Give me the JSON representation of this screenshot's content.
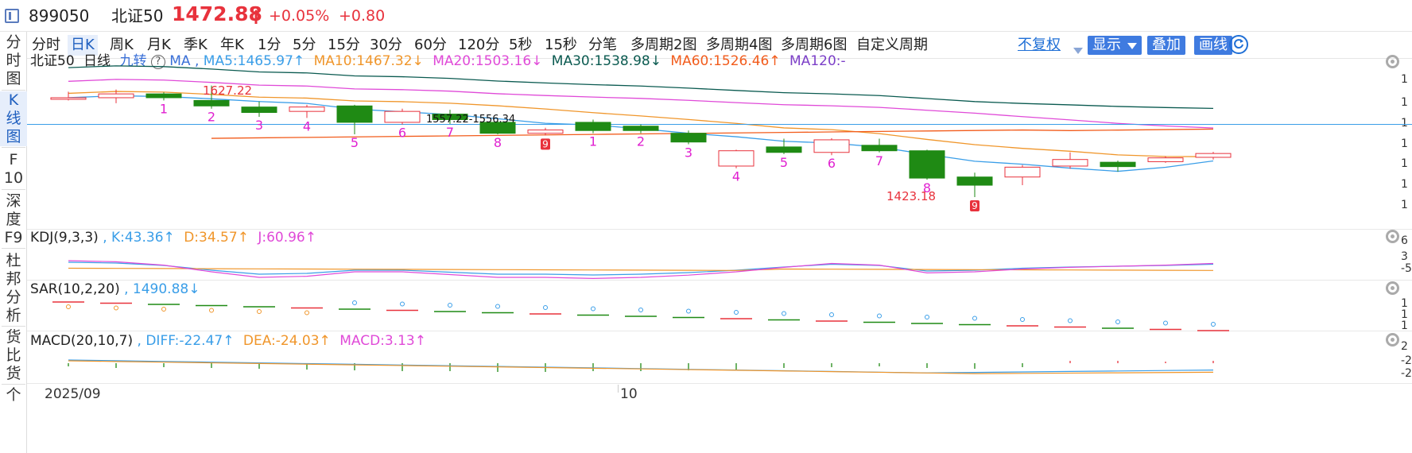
{
  "header": {
    "code": "899050",
    "name": "北证50",
    "price": "1472.88",
    "change_pct": "+0.05%",
    "change": "+0.80",
    "up_color": "#e8323c"
  },
  "left_nav": {
    "items": [
      "分时图",
      "K线图",
      "F10",
      "深度F9",
      "杜邦分析",
      "货比货",
      "个"
    ],
    "active_index": 1
  },
  "toolbar": {
    "periods": [
      "分时",
      "日K",
      "周K",
      "月K",
      "季K",
      "年K",
      "1分",
      "5分",
      "15分",
      "30分",
      "60分",
      "120分",
      "5秒",
      "15秒",
      "分笔",
      "多周期2图",
      "多周期4图",
      "多周期6图",
      "自定义周期"
    ],
    "active_index": 1,
    "adjust_label": "不复权",
    "display_label": "显示",
    "overlay_label": "叠加",
    "draw_label": "画线"
  },
  "main_legend": {
    "name": "北证50",
    "period": "日线",
    "nine_turn": "九转",
    "ma_label": "MA ,",
    "ma5": "MA5:1465.97↑",
    "ma10": "MA10:1467.32↓",
    "ma20": "MA20:1503.16↓",
    "ma30": "MA30:1538.98↓",
    "ma60": "MA60:1526.46↑",
    "ma120": "MA120:-",
    "high_label": "1627.22",
    "low_label": "1423.18",
    "range_label": "1557.22-1556.34"
  },
  "kdj_legend": {
    "name": "KDJ(9,3,3)",
    "k": ", K:43.36↑",
    "d": "D:34.57↑",
    "j": "J:60.96↑"
  },
  "sar_legend": {
    "name": "SAR(10,2,20)",
    "value": ", 1490.88↓"
  },
  "macd_legend": {
    "name": "MACD(20,10,7)",
    "diff": ", DIFF:-22.47↑",
    "dea": "DEA:-24.03↑",
    "macd": "MACD:3.13↑"
  },
  "right_axis": {
    "main": [
      "1",
      "1",
      "1",
      "1",
      "1",
      "1",
      "1"
    ],
    "kdj": [
      "6",
      "3",
      "-5"
    ],
    "sar": [
      "1",
      "1",
      "1"
    ],
    "macd": [
      "2",
      "-2",
      "-2"
    ]
  },
  "x_axis": {
    "labels": [
      "2025/09",
      "10"
    ]
  },
  "colors": {
    "up": "#e8323c",
    "down": "#1f8a14",
    "ma5": "#3a9ee8",
    "ma10": "#f0962b",
    "ma20": "#e04ad8",
    "ma30": "#0a5a50",
    "ma60": "#f25c1c",
    "ma120": "#7c3fc8",
    "nine_turn": "#e020d0"
  },
  "chart_data": {
    "type": "candlestick",
    "ylim": [
      1400,
      1650
    ],
    "candles": [
      {
        "o": 1605,
        "c": 1605,
        "h": 1616,
        "l": 1600
      },
      {
        "o": 1605,
        "c": 1612,
        "h": 1620,
        "l": 1595
      },
      {
        "o": 1612,
        "c": 1605,
        "h": 1615,
        "l": 1600
      },
      {
        "o": 1600,
        "c": 1590,
        "h": 1627.22,
        "l": 1585
      },
      {
        "o": 1588,
        "c": 1578,
        "h": 1598,
        "l": 1570
      },
      {
        "o": 1580,
        "c": 1588,
        "h": 1592,
        "l": 1568
      },
      {
        "o": 1590,
        "c": 1560,
        "h": 1592,
        "l": 1538
      },
      {
        "o": 1560,
        "c": 1580,
        "h": 1585,
        "l": 1556
      },
      {
        "o": 1575,
        "c": 1565,
        "h": 1583,
        "l": 1557.22
      },
      {
        "o": 1560,
        "c": 1540,
        "h": 1565,
        "l": 1538
      },
      {
        "o": 1540,
        "c": 1546,
        "h": 1550,
        "l": 1536
      },
      {
        "o": 1560,
        "c": 1545,
        "h": 1565,
        "l": 1540
      },
      {
        "o": 1553,
        "c": 1545,
        "h": 1556,
        "l": 1540
      },
      {
        "o": 1540,
        "c": 1524,
        "h": 1545,
        "l": 1520
      },
      {
        "o": 1480,
        "c": 1508,
        "h": 1510,
        "l": 1476
      },
      {
        "o": 1515,
        "c": 1505,
        "h": 1530,
        "l": 1502
      },
      {
        "o": 1505,
        "c": 1528,
        "h": 1531,
        "l": 1500
      },
      {
        "o": 1518,
        "c": 1508,
        "h": 1530,
        "l": 1505
      },
      {
        "o": 1508,
        "c": 1458,
        "h": 1510,
        "l": 1455
      },
      {
        "o": 1460,
        "c": 1445,
        "h": 1468,
        "l": 1423.18
      },
      {
        "o": 1460,
        "c": 1478,
        "h": 1482,
        "l": 1445
      },
      {
        "o": 1480,
        "c": 1492,
        "h": 1505,
        "l": 1475
      },
      {
        "o": 1487,
        "c": 1479,
        "h": 1490,
        "l": 1470
      },
      {
        "o": 1488,
        "c": 1495,
        "h": 1498,
        "l": 1486
      },
      {
        "o": 1496,
        "c": 1503,
        "h": 1506,
        "l": 1492
      }
    ],
    "nine_turn_marks": [
      "1",
      "2",
      "3",
      "4",
      "5",
      "6",
      "7",
      "8",
      "9",
      "1",
      "2",
      "3",
      "4",
      "5",
      "6",
      "7",
      "8",
      "9"
    ],
    "x_labels": [
      "2025/09",
      "10"
    ]
  }
}
